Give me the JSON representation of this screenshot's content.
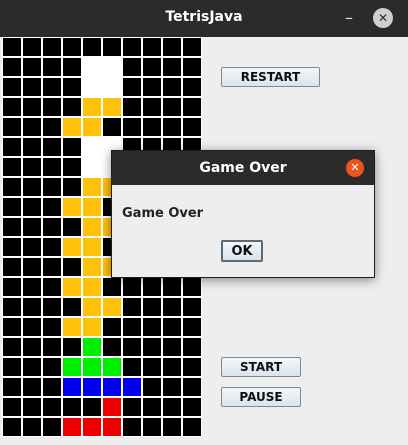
{
  "window": {
    "title": "TetrisJava"
  },
  "controls": {
    "minimize_icon": "minimize-icon",
    "close_icon": "close-icon"
  },
  "board": {
    "cols": 10,
    "rows": 20,
    "grid_color": "#ffffff",
    "background": "#000000",
    "colors": {
      "W": "#ffffff",
      "Y": "#ffc10a",
      "G": "#00ee00",
      "B": "#0000ee",
      "R": "#ee0000"
    },
    "cells": [
      "..........",
      "....WW....",
      "....WW....",
      "....YY....",
      "...YY.....",
      "....WW....",
      "....WW....",
      "....YY....",
      "...YY.....",
      "....YY....",
      "...YY.....",
      "....YY....",
      "...YY.....",
      "....YY....",
      "...YY.....",
      "....G.....",
      "...GGG....",
      "...BBBB...",
      ".....R....",
      "...RRR...."
    ]
  },
  "buttons": {
    "restart": "RESTART",
    "start": "START",
    "pause": "PAUSE"
  },
  "dialog": {
    "title": "Game Over",
    "message": "Game Over",
    "ok_label": "OK",
    "close_color": "#e95420"
  }
}
